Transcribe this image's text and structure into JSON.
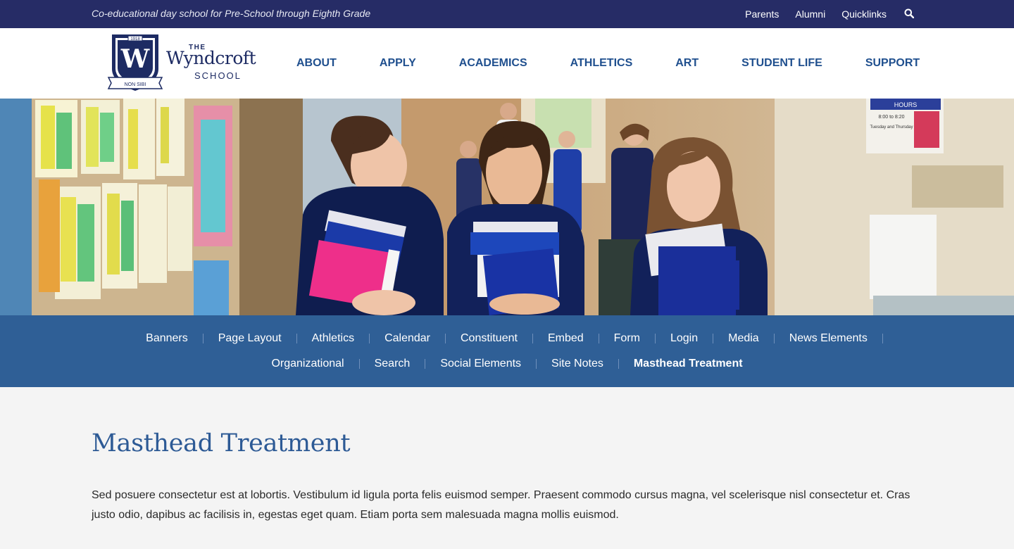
{
  "utility": {
    "tagline": "Co-educational day school for Pre-School through Eighth Grade",
    "links": [
      "Parents",
      "Alumni",
      "Quicklinks"
    ],
    "search_icon": "search-icon"
  },
  "logo": {
    "the": "THE",
    "name": "Wyndcroft",
    "school": "SCHOOL",
    "crest_letter": "W",
    "crest_year": "1918",
    "crest_motto": "NON SIBI"
  },
  "nav": {
    "items": [
      "ABOUT",
      "APPLY",
      "ACADEMICS",
      "ATHLETICS",
      "ART",
      "STUDENT LIFE",
      "SUPPORT"
    ]
  },
  "subnav": {
    "row1": [
      "Banners",
      "Page Layout",
      "Athletics",
      "Calendar",
      "Constituent",
      "Embed",
      "Form",
      "Login",
      "Media",
      "News Elements"
    ],
    "row2": [
      "Organizational",
      "Search",
      "Social Elements",
      "Site Notes",
      "Masthead Treatment"
    ],
    "active": "Masthead Treatment"
  },
  "content": {
    "title": "Masthead Treatment",
    "body": "Sed posuere consectetur est at lobortis. Vestibulum id ligula porta felis euismod semper. Praesent commodo cursus magna, vel scelerisque nisl consectetur et. Cras justo odio, dapibus ac facilisis in, egestas eget quam. Etiam porta sem malesuada magna mollis euismod."
  },
  "hero": {
    "sign_title": "HOURS",
    "sign_time": "8:00 to 8:20",
    "sign_days": "Tuesday and Thursday"
  },
  "colors": {
    "utility_bar": "#262c66",
    "nav_text": "#1f4f8e",
    "subnav_bg": "#2f5f96",
    "title": "#2d5a95"
  }
}
